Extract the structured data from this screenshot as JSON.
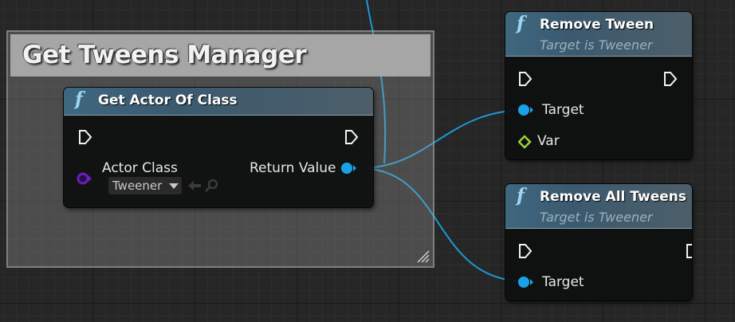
{
  "comment": {
    "title": "Get Tweens Manager"
  },
  "nodes": {
    "get_actor": {
      "title": "Get Actor Of Class",
      "actor_class_label": "Actor Class",
      "actor_class_value": "Tweener",
      "return_label": "Return Value"
    },
    "remove_tween": {
      "title": "Remove Tween",
      "subtitle": "Target is Tweener",
      "target_label": "Target",
      "var_label": "Var"
    },
    "remove_all": {
      "title": "Remove All Tweens",
      "subtitle": "Target is Tweener",
      "target_label": "Target"
    }
  },
  "colors": {
    "object_pin": "#1ba2e6",
    "class_pin": "#6a1fb8",
    "var_pin": "#9cd03b",
    "wire": "#1b9ad6"
  },
  "icons": [
    "function-icon",
    "exec-pin-icon",
    "object-pin-icon",
    "class-pin-icon",
    "diamond-pin-icon",
    "use-selected-arrow-icon",
    "browse-magnifier-icon",
    "resize-grip-icon"
  ]
}
